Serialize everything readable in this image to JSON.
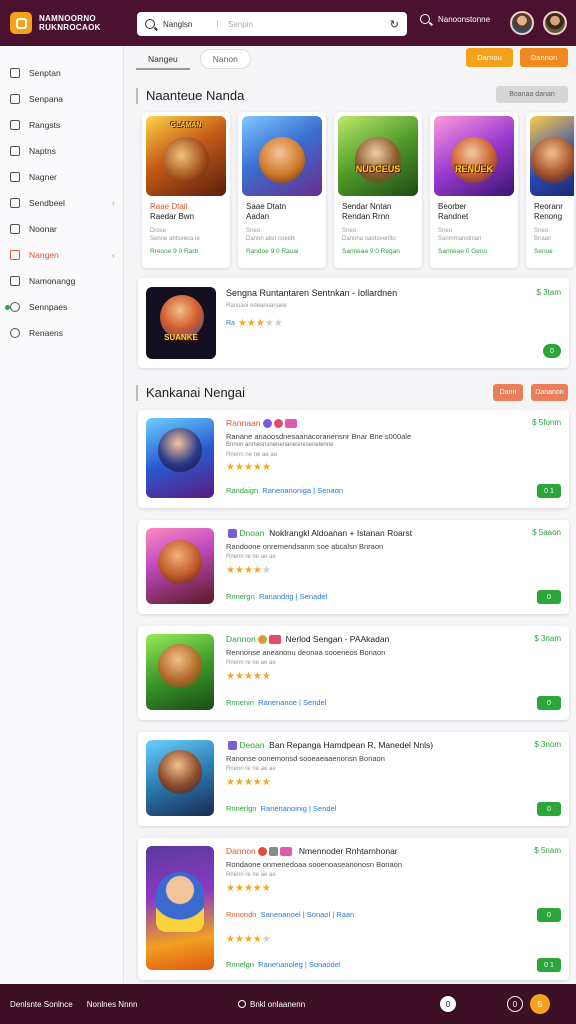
{
  "header": {
    "logo_line1": "NAMNOORNO",
    "logo_line2": "RUKNROCAOK",
    "search_query": "Nanglsn",
    "search_placeholder": "Senpin",
    "right_label": "Nanoonstonne"
  },
  "sidebar": {
    "items": [
      {
        "label": "Senptan"
      },
      {
        "label": "Senpana"
      },
      {
        "label": "Rangsts"
      },
      {
        "label": "Naptns"
      },
      {
        "label": "Nagner"
      },
      {
        "label": "Sendbeel"
      },
      {
        "label": "Noonar"
      },
      {
        "label": "Nangen"
      },
      {
        "label": "Namonangg"
      },
      {
        "label": "Sennpaes"
      },
      {
        "label": "Renaens"
      }
    ]
  },
  "tabs": {
    "tab1": "Nangeu",
    "tab2": "Nanon",
    "btn1": "Darnou",
    "btn2": "Dannon"
  },
  "section1": {
    "title": "Naanteue Nanda",
    "pill": "Boanaa danan"
  },
  "cards": [
    {
      "art_label": "GLAMAN",
      "title_o": "Raae Dtail",
      "title": "Raedar Bwn",
      "meta1": "Drose",
      "meta2": "Senne ahtseeca ie",
      "green": "Rreone 9 0 Rarb"
    },
    {
      "art_label": "",
      "title_o": "",
      "title": "Saae Dtatn",
      "title2": "Aadan",
      "meta1": "Sneo",
      "meta2": "Danon alsn coeidk",
      "green": "Randoe 9 0 Rauai"
    },
    {
      "art_label": "NUDCEUS",
      "title_o": "",
      "title": "Sendar Nntan",
      "title2": "Rendan Rrnn",
      "meta1": "Sneo",
      "meta2": "Danona oaotseenlto",
      "green": "Sanneaa 9 0 Regan"
    },
    {
      "art_label": "RENUEK",
      "title_o": "",
      "title": "Beorber",
      "title2": "Randnet",
      "meta1": "Sneu",
      "meta2": "Sanmmanstnlan",
      "green": "Sanneae 0 Geno"
    },
    {
      "art_label": "",
      "title_o": "",
      "title": "Reoranr",
      "title2": "Renong",
      "meta1": "Sneo",
      "meta2": "Bnaan",
      "green": "Senue"
    }
  ],
  "featured": {
    "art_label": "SUANKE",
    "title": "Sengna Runtantaren Sentnkan - Iollardnen",
    "meta": "Ranuaoi edeanoanaee",
    "badge": "Ra",
    "rating": 3,
    "price": "$ 3tam",
    "btn": "0"
  },
  "section2": {
    "title": "Kankanai Nengai",
    "btn1": "Dann",
    "btn2": "Dananon"
  },
  "rows": [
    {
      "lead": "Rannaan",
      "title": "",
      "line1": "Ranane anaoosdnesaanacoranensnr Bnar Bne s000ale",
      "line2": "Bnnon anmesnsnenenanesnesenelenne",
      "small": "Rnenn ne ne ae ae",
      "rating": 4.5,
      "links_g": "Randaign",
      "links_b": "Ranenanoniga | Senaon",
      "price": "$ 5fonm",
      "btn": "0 1"
    },
    {
      "lead": "Dnoan",
      "title": "Noklrangkl Aldoanan + Istanan Roarst",
      "line1": "Randoone onremendsanm soe abcalsn Bnraon",
      "line2": "",
      "small": "Rnenn re ne ae ae",
      "rating": 4,
      "links_g": "Rnnergn",
      "links_b": "Ranandrig | Senadel",
      "price": "$ 5aaon",
      "btn": "0"
    },
    {
      "lead": "Dannon",
      "title": "Nerlod Sengan - PAAkadan",
      "line1": "Rennonse aneanonu deonaa sooeneos Bonaon",
      "line2": "",
      "small": "Rnenn re ne ae ae",
      "rating": 4.5,
      "links_g": "Rnnenin",
      "links_b": "Ranenanoe | Sendel",
      "price": "$ 3nam",
      "btn": "0"
    },
    {
      "lead": "Deoan",
      "title": "Ban Repanga Hamdpean R, Manedel Nnls)",
      "line1": "Ranonse oonemonsd sooeaeaaenonsn Bonaon",
      "line2": "",
      "small": "Rnenn re ne ae ae",
      "rating": 4.5,
      "links_g": "Rnnerlgn",
      "links_b": "Ranenanoinig | Sendel",
      "price": "$ 3nom",
      "btn": "0"
    },
    {
      "lead": "Dannon",
      "title": "Nmennoder Rnhtarnhonar",
      "line1": "Rondaone onmenedoaa sooenoaseanonosn Bonaon",
      "line2": "",
      "small": "Rnenn re ne ae ae",
      "rating": 4.5,
      "links_g": "Rnnondn",
      "links_b": "Sanenanoel | Sonaol | Raan",
      "rating2": 4,
      "links2_g": "Rnnelgn",
      "links2_b": "Ranenanoleg | Sonaodel",
      "price": "$ 5nam",
      "btn": "0",
      "btn2": "0 1"
    }
  ],
  "footer": {
    "left": "Denlsnte Sonlnce",
    "left2": "Nonlnes Nnnn",
    "center": "Bnkl onlaanenn",
    "b1": "0",
    "b2": "0",
    "b3": "5"
  },
  "colors": {
    "topbar": "#4b1230",
    "accent": "#f4a21c",
    "green": "#2aa63a",
    "orange": "#e2582b"
  }
}
